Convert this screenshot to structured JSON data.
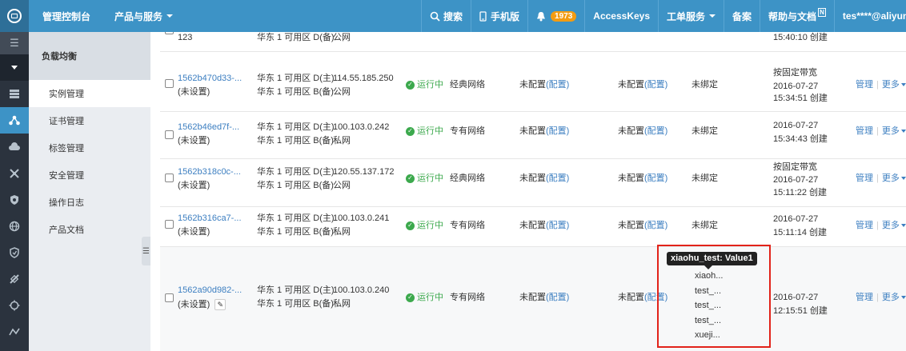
{
  "topbar": {
    "title": "管理控制台",
    "products": "产品与服务",
    "search": "搜索",
    "mobile": "手机版",
    "notifications": "1973",
    "accesskeys": "AccessKeys",
    "tickets": "工单服务",
    "beian": "备案",
    "help": "帮助与文档",
    "help_badge": "N",
    "user": "tes****@aliyun.com"
  },
  "subnav": {
    "title": "负载均衡",
    "items": [
      "实例管理",
      "证书管理",
      "标签管理",
      "安全管理",
      "操作日志",
      "产品文档"
    ]
  },
  "table": {
    "partial_row": {
      "name": "123",
      "zone1": "华东 1 可用区 D(备)",
      "ip_type": "公网",
      "date": "2016-07-27",
      "time": "15:40:10 创建"
    },
    "rows": [
      {
        "id": "1562b470d33-...",
        "name": "(未设置)",
        "zone1": "华东 1 可用区 D(主)",
        "zone2": "华东 1 可用区 B(备)",
        "ip": "114.55.185.250",
        "ip_type": "公网",
        "status": "运行中",
        "network": "经典网络",
        "cfg1": "未配置",
        "cfg1_link": "(配置)",
        "cfg2": "未配置",
        "cfg2_link": "(配置)",
        "tag": "未绑定",
        "bandwidth": "按固定带宽",
        "date": "2016-07-27",
        "time": "15:34:51 创建"
      },
      {
        "id": "1562b46ed7f-...",
        "name": "(未设置)",
        "zone1": "华东 1 可用区 D(主)",
        "zone2": "华东 1 可用区 B(备)",
        "ip": "100.103.0.242",
        "ip_type": "私网",
        "status": "运行中",
        "network": "专有网络",
        "cfg1": "未配置",
        "cfg1_link": "(配置)",
        "cfg2": "未配置",
        "cfg2_link": "(配置)",
        "tag": "未绑定",
        "bandwidth": "",
        "date": "2016-07-27",
        "time": "15:34:43 创建"
      },
      {
        "id": "1562b318c0c-...",
        "name": "(未设置)",
        "zone1": "华东 1 可用区 D(主)",
        "zone2": "华东 1 可用区 B(备)",
        "ip": "120.55.137.172",
        "ip_type": "公网",
        "status": "运行中",
        "network": "经典网络",
        "cfg1": "未配置",
        "cfg1_link": "(配置)",
        "cfg2": "未配置",
        "cfg2_link": "(配置)",
        "tag": "未绑定",
        "bandwidth": "按固定带宽",
        "date": "2016-07-27",
        "time": "15:11:22 创建"
      },
      {
        "id": "1562b316ca7-...",
        "name": "(未设置)",
        "zone1": "华东 1 可用区 D(主)",
        "zone2": "华东 1 可用区 B(备)",
        "ip": "100.103.0.241",
        "ip_type": "私网",
        "status": "运行中",
        "network": "专有网络",
        "cfg1": "未配置",
        "cfg1_link": "(配置)",
        "cfg2": "未配置",
        "cfg2_link": "(配置)",
        "tag": "未绑定",
        "bandwidth": "",
        "date": "2016-07-27",
        "time": "15:11:14 创建"
      },
      {
        "id": "1562a90d982-...",
        "name": "(未设置)",
        "zone1": "华东 1 可用区 D(主)",
        "zone2": "华东 1 可用区 B(备)",
        "ip": "100.103.0.240",
        "ip_type": "私网",
        "status": "运行中",
        "network": "专有网络",
        "cfg1": "未配置",
        "cfg1_link": "(配置)",
        "cfg2": "未配置",
        "cfg2_link": "(配置)",
        "tag": "",
        "bandwidth": "",
        "date": "2016-07-27",
        "time": "12:15:51 创建"
      }
    ],
    "actions": {
      "manage": "管理",
      "more": "更多"
    }
  },
  "tag_popover": {
    "tooltip": "xiaohu_test:  Value1",
    "tags": [
      "xiaoh...",
      "test_...",
      "test_...",
      "test_...",
      "xueji..."
    ]
  },
  "colors": {
    "topbar": "#3d93c6",
    "rail": "#2b333e",
    "link": "#3d7fc1",
    "running": "#3ca94d",
    "highlight_border": "#e2231a",
    "badge": "#f39c12"
  }
}
